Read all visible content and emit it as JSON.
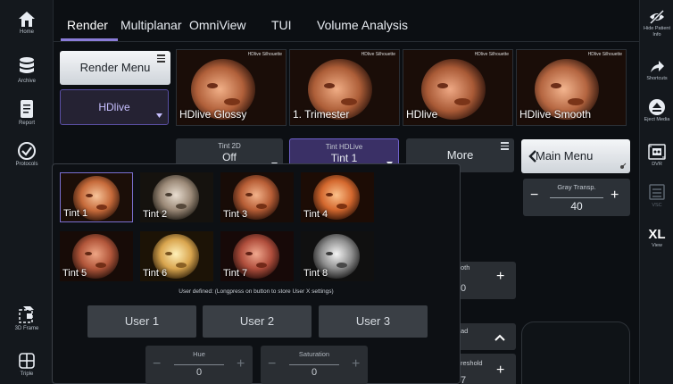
{
  "sidebar": {
    "items": [
      {
        "label": "Home",
        "icon": "home-icon"
      },
      {
        "label": "Archive",
        "icon": "database-icon"
      },
      {
        "label": "Report",
        "icon": "report-icon"
      },
      {
        "label": "Protocols",
        "icon": "check-circle-icon"
      },
      {
        "label": "3D Frame",
        "icon": "cube-frame-icon"
      },
      {
        "label": "Triple",
        "icon": "triple-layout-icon"
      }
    ]
  },
  "rightbar": {
    "items": [
      {
        "label": "Hide Patient Info",
        "icon": "eye-off-icon"
      },
      {
        "label": "Shortcuts",
        "icon": "arrow-right-icon"
      },
      {
        "label": "Eject Media",
        "icon": "eject-icon"
      },
      {
        "label": "DVR",
        "icon": "dvr-icon"
      },
      {
        "label": "VSC",
        "icon": "vsc-icon"
      },
      {
        "label": "View",
        "big": "XL"
      }
    ]
  },
  "tabs": [
    "Render",
    "Multiplanar",
    "OmniView",
    "TUI",
    "Volume Analysis"
  ],
  "active_tab": "Render",
  "render_menu_label": "Render Menu",
  "mode_label": "HDlive",
  "presets": [
    {
      "label": "HDlive Glossy",
      "tag": "HDlive Silhouette"
    },
    {
      "label": "1. Trimester",
      "tag": "HDlive Silhouette"
    },
    {
      "label": "HDlive",
      "tag": "HDlive Silhouette"
    },
    {
      "label": "HDlive Smooth",
      "tag": "HDlive Silhouette"
    }
  ],
  "controls": {
    "tint2d": {
      "title": "Tint 2D",
      "value": "Off"
    },
    "tint_hdlive": {
      "title": "Tint HDLive",
      "value": "Tint 1"
    },
    "more": "More",
    "main_menu": "Main Menu",
    "gray_transp": {
      "title": "Gray Transp.",
      "value": "40",
      "minus": "−",
      "plus": "+"
    }
  },
  "tint_popup": {
    "tints": [
      "Tint 1",
      "Tint 2",
      "Tint 3",
      "Tint 4",
      "Tint 5",
      "Tint 6",
      "Tint 7",
      "Tint 8"
    ],
    "selected": "Tint 1",
    "note": "User defined: (Longpress on button to store User X settings)",
    "users": [
      "User 1",
      "User 2",
      "User 3"
    ],
    "hue": {
      "title": "Hue",
      "value": "0",
      "minus": "−",
      "plus": "+"
    },
    "saturation": {
      "title": "Saturation",
      "value": "0",
      "minus": "−",
      "plus": "+"
    }
  },
  "partial": {
    "smooth_title": "oth",
    "smooth_value": "0",
    "plus": "+",
    "load_title": "ad",
    "threshold_title": "reshold",
    "threshold_value": "7"
  },
  "colors": {
    "accent": "#8a7cd8",
    "tint_selected_border": "#7a6fd0",
    "panel": "#2c3137",
    "background": "#0c0f13"
  }
}
